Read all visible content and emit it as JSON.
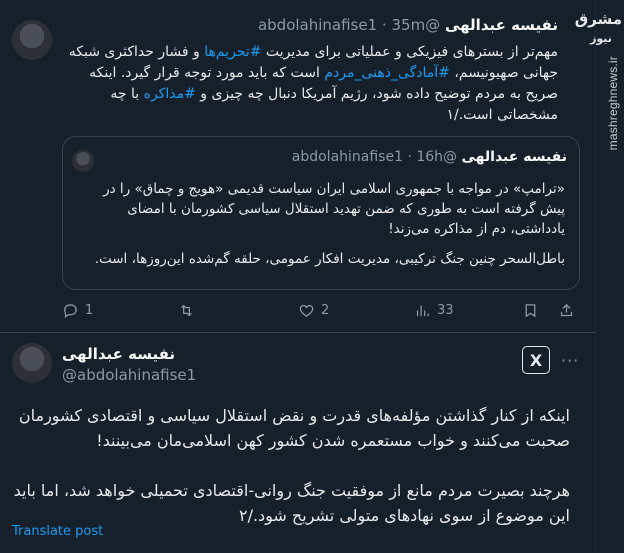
{
  "watermark": {
    "logo": "مشرق",
    "logo_sub": "نیوز",
    "text": "mashreghnews.ir"
  },
  "tweet1": {
    "name": "نفیسه عبدالهی",
    "handle": "@abdolahinafise1",
    "time": "35m",
    "body_parts": [
      "مهم‌تر از بسترهای فیزیکی و عملیاتی برای مدیریت ",
      "#تحریم‌ها",
      " و فشار حداکثری شبکه جهانی صهیونیسم، ",
      "#آمادگی_ذهنی_مردم",
      " است که باید مورد توجه قرار گیرد. اینکه صریح به مردم توضیح داده شود، رژیم آمریکا دنبال چه چیزی و ",
      "#مذاکره",
      " با چه مشخصاتی است./۱"
    ],
    "quote": {
      "name": "نفیسه عبدالهی",
      "handle": "@abdolahinafise1",
      "time": "16h",
      "para1": "«ترامپ» در مواجه با جمهوری اسلامی ایران سیاست قدیمی «هویج و چماق» را در پیش گرفته است به طوری که ضمن تهدید استقلال سیاسی کشورمان با امضای یادداشتی، دم از مذاکره می‌زند!",
      "para2": "باطل‌السحر چنین جنگ ترکیبی، مدیریت افکار عمومی، حلقه گم‌شده این‌روزها، است."
    },
    "actions": {
      "replies": "1",
      "reposts": "",
      "likes": "2",
      "views": "33"
    }
  },
  "tweet2": {
    "name": "نفیسه عبدالهی",
    "handle": "@abdolahinafise1",
    "para1": "اینکه از کنار گذاشتن مؤلفه‌های قدرت و نقض استقلال سیاسی و اقتصادی کشورمان صحبت می‌کنند و خواب مستعمره شدن کشور کهن اسلامی‌مان می‌بینند!",
    "para2": "هرچند بصیرت مردم مانع از موفقیت جنگ روانی-اقتصادی تحمیلی خواهد شد، اما باید این موضوع از سوی نهادهای متولی تشریح شود./۲",
    "translate": "Translate post"
  },
  "colors": {
    "background": "#15202b",
    "accent": "#1d9bf0",
    "muted": "#8b98a5",
    "border": "#38444d"
  },
  "icons": {
    "reply": "reply-icon",
    "repost": "repost-icon",
    "like": "heart-icon",
    "views": "views-icon",
    "more": "more-icon",
    "x": "x-logo-icon"
  }
}
